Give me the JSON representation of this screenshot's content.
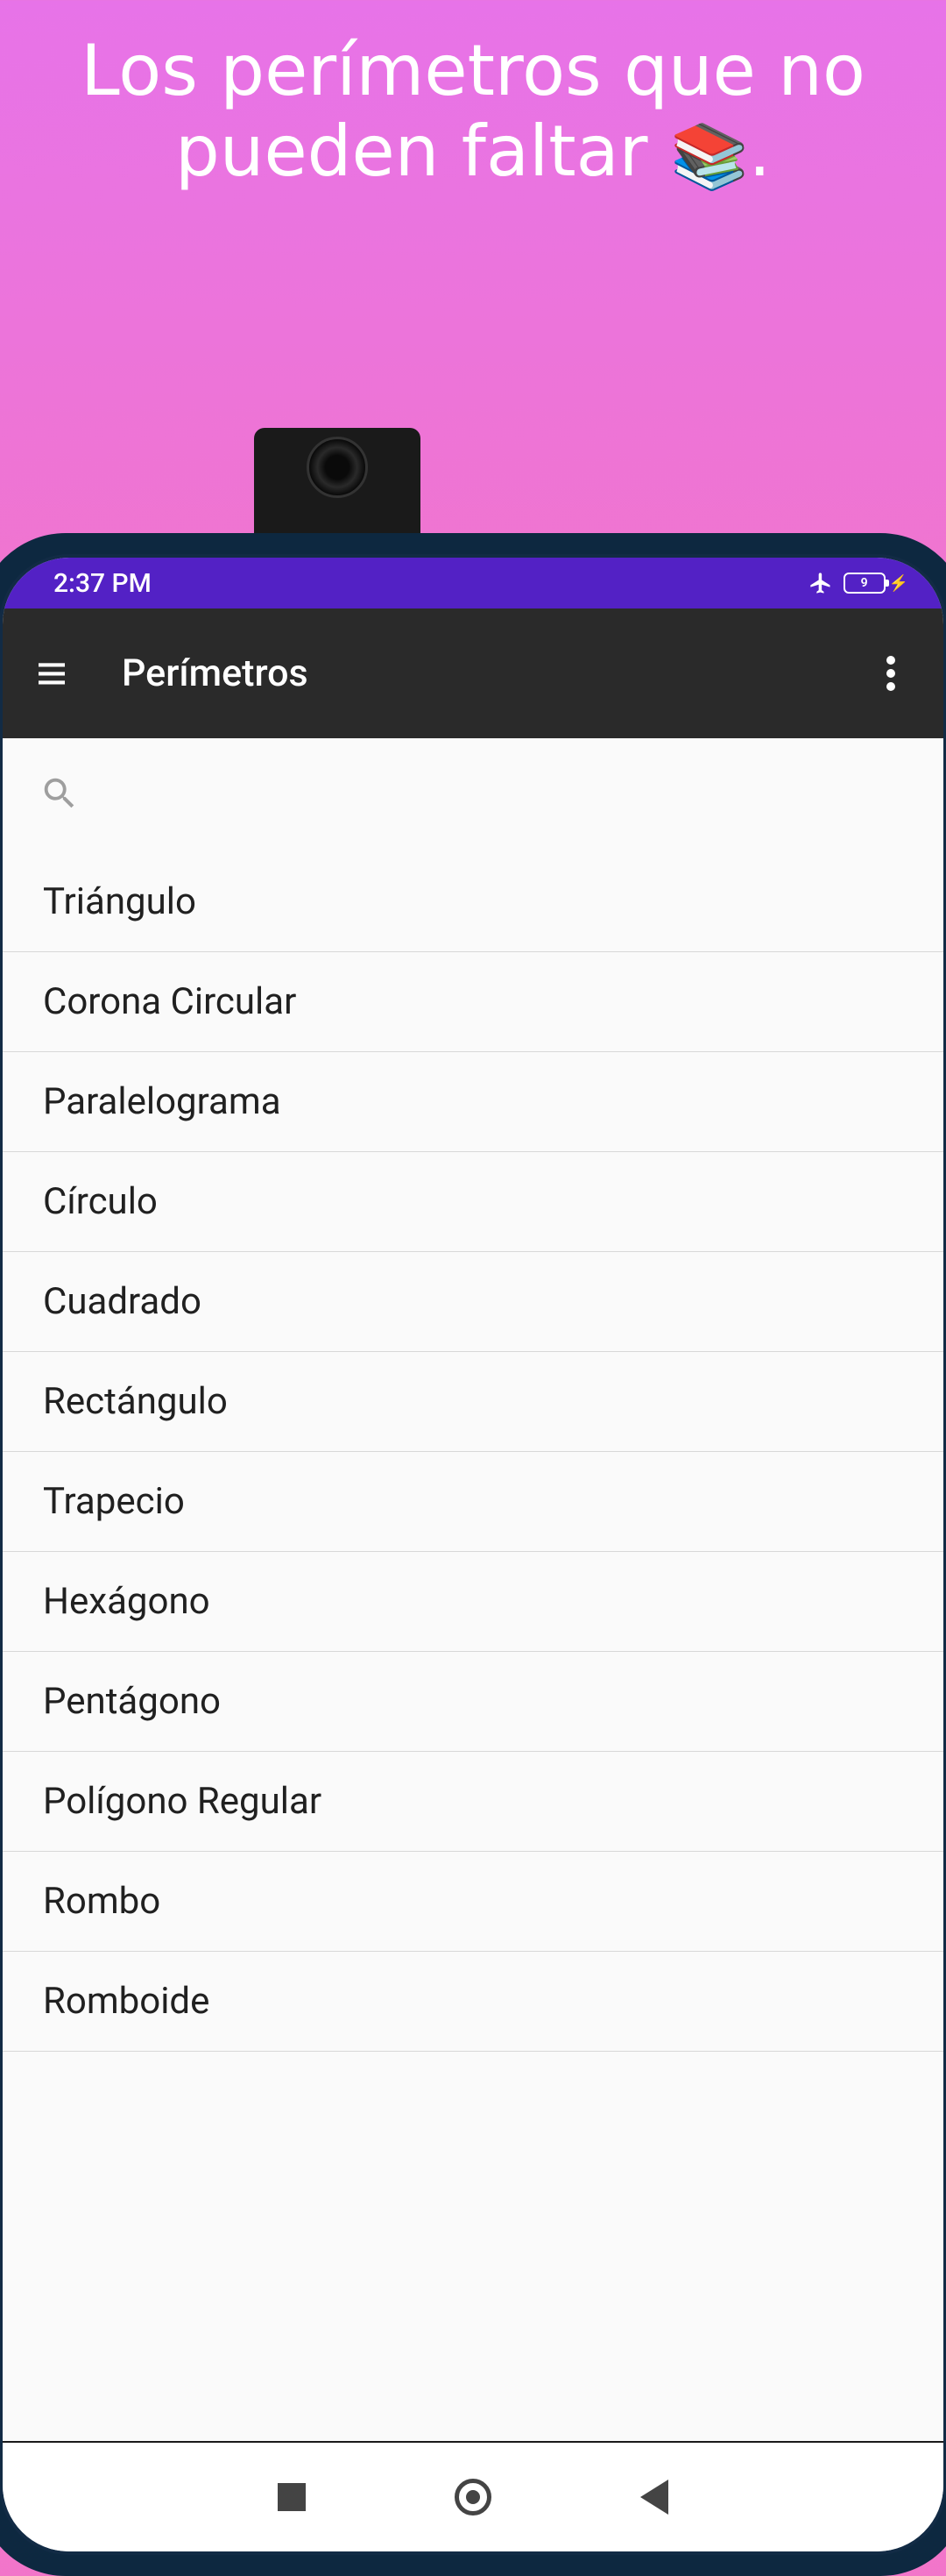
{
  "promo": {
    "headline_line1": "Los perímetros que no",
    "headline_line2": "pueden faltar",
    "emoji": "📚"
  },
  "status_bar": {
    "time": "2:37 PM",
    "battery_level": "9"
  },
  "app_bar": {
    "title": "Perímetros"
  },
  "list": {
    "items": [
      "Triángulo",
      "Corona Circular",
      "Paralelograma",
      "Círculo",
      "Cuadrado",
      "Rectángulo",
      "Trapecio",
      "Hexágono",
      "Pentágono",
      "Polígono Regular",
      "Rombo",
      "Romboide"
    ]
  }
}
